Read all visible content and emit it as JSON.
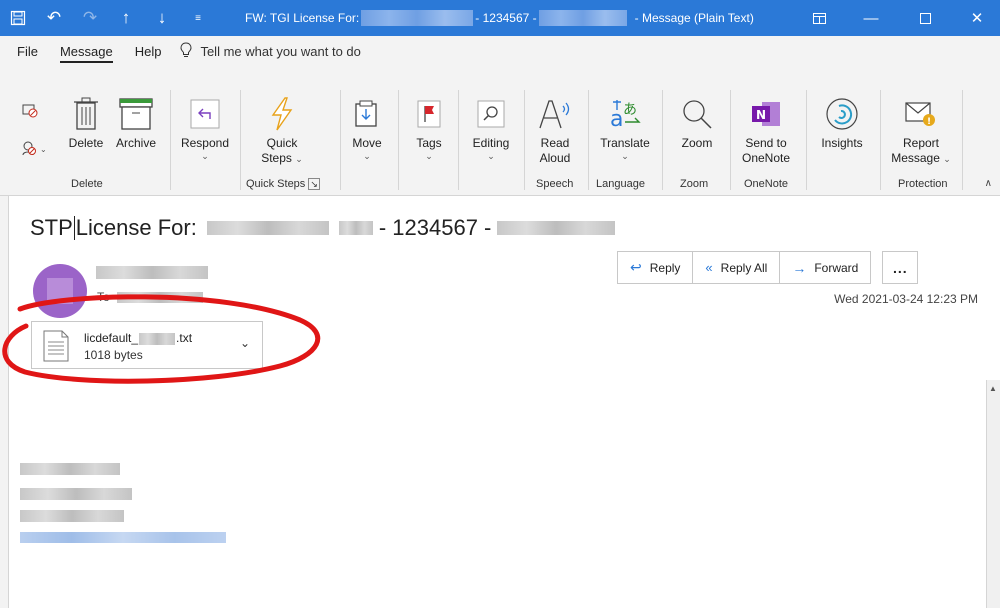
{
  "titlebar": {
    "title_prefix": "FW: TGI License For:",
    "title_number": "- 1234567 -",
    "title_suffix": "- Message (Plain Text)",
    "bg_color": "#2b79d7",
    "icons": [
      "save-icon",
      "undo-icon",
      "redo-icon",
      "up-arrow-icon",
      "down-arrow-icon",
      "customize-icon"
    ],
    "buttons": [
      "restore-ribbon-icon",
      "minimize-icon",
      "maximize-icon",
      "close-icon"
    ]
  },
  "tabs": [
    {
      "label": "File"
    },
    {
      "label": "Message",
      "active": true
    },
    {
      "label": "Help"
    }
  ],
  "tellme": {
    "label": "Tell me what you want to do"
  },
  "ribbon": {
    "delete_label": "Delete",
    "archive_label": "Archive",
    "respond_label": "Respond",
    "quicksteps_label1": "Quick",
    "quicksteps_label2": "Steps",
    "move_label": "Move",
    "tags_label": "Tags",
    "editing_label": "Editing",
    "read_label1": "Read",
    "read_label2": "Aloud",
    "translate_label": "Translate",
    "zoom_label": "Zoom",
    "onenote_label1": "Send to",
    "onenote_label2": "OneNote",
    "insights_label": "Insights",
    "report_label1": "Report",
    "report_label2": "Message",
    "groups": {
      "delete": "Delete",
      "quicksteps": "Quick Steps",
      "speech": "Speech",
      "language": "Language",
      "zoom": "Zoom",
      "onenote": "OneNote",
      "protection": "Protection"
    }
  },
  "message": {
    "subject_prefix": "STP",
    "subject_main": "License For:",
    "subject_number": "- 1234567 -",
    "to_label": "To",
    "date": "Wed 2021-03-24 12:23 PM",
    "actions": {
      "reply": "Reply",
      "reply_all": "Reply All",
      "forward": "Forward",
      "more": "..."
    },
    "attachment": {
      "name_prefix": "licdefault_",
      "name_suffix": ".txt",
      "size": "1018 bytes"
    }
  },
  "colors": {
    "accent": "#2b79d7",
    "annotation": "#e01616",
    "avatar": "#9b64c8"
  }
}
